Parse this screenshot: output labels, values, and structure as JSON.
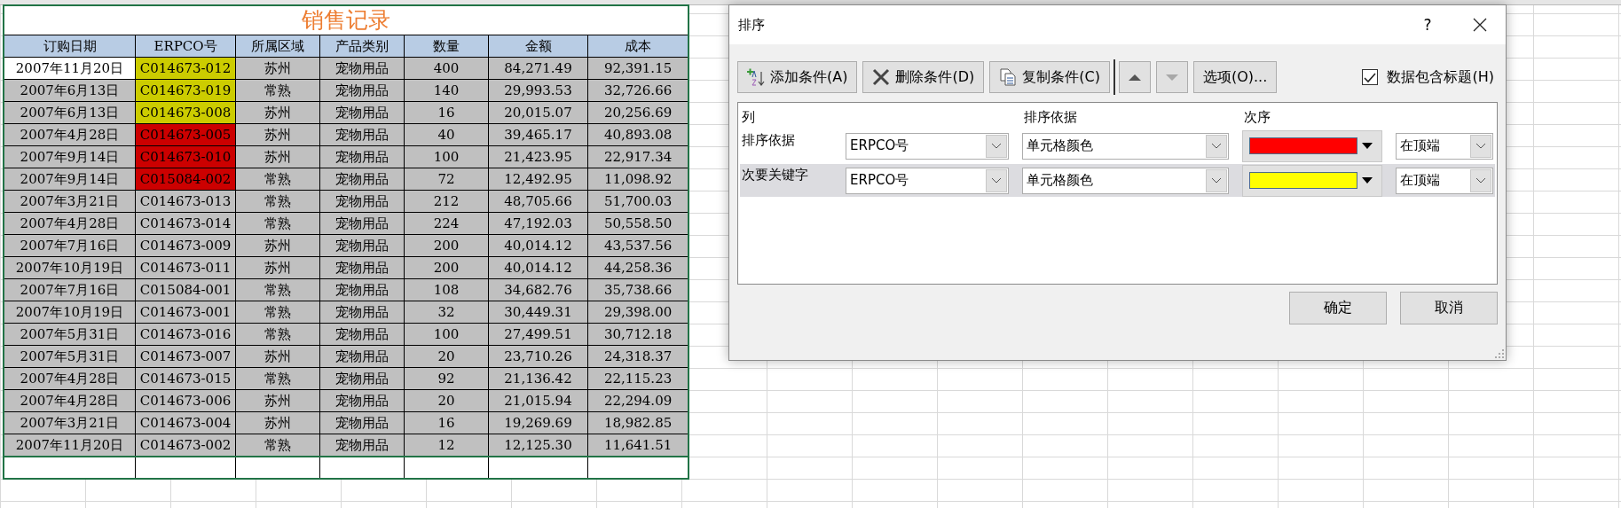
{
  "sheet": {
    "title": "销售记录",
    "columns": [
      "订购日期",
      "ERPCO号",
      "所属区域",
      "产品类别",
      "数量",
      "金额",
      "成本"
    ],
    "rows": [
      {
        "date": "2007年11月20日",
        "erpco": "C014673-012",
        "color": "#cccc00",
        "selected": true,
        "region": "苏州",
        "category": "宠物用品",
        "qty": "400",
        "amount": "84,271.49",
        "cost": "92,391.15"
      },
      {
        "date": "2007年6月13日",
        "erpco": "C014673-019",
        "color": "#cccc00",
        "selected": false,
        "region": "常熟",
        "category": "宠物用品",
        "qty": "140",
        "amount": "29,993.53",
        "cost": "32,726.66"
      },
      {
        "date": "2007年6月13日",
        "erpco": "C014673-008",
        "color": "#cccc00",
        "selected": false,
        "region": "苏州",
        "category": "宠物用品",
        "qty": "16",
        "amount": "20,015.07",
        "cost": "20,256.69"
      },
      {
        "date": "2007年4月28日",
        "erpco": "C014673-005",
        "color": "#cc0000",
        "selected": false,
        "region": "苏州",
        "category": "宠物用品",
        "qty": "40",
        "amount": "39,465.17",
        "cost": "40,893.08"
      },
      {
        "date": "2007年9月14日",
        "erpco": "C014673-010",
        "color": "#cc0000",
        "selected": false,
        "region": "苏州",
        "category": "宠物用品",
        "qty": "100",
        "amount": "21,423.95",
        "cost": "22,917.34"
      },
      {
        "date": "2007年9月14日",
        "erpco": "C015084-002",
        "color": "#cc0000",
        "selected": false,
        "region": "常熟",
        "category": "宠物用品",
        "qty": "72",
        "amount": "12,492.95",
        "cost": "11,098.92"
      },
      {
        "date": "2007年3月21日",
        "erpco": "C014673-013",
        "selected": false,
        "region": "常熟",
        "category": "宠物用品",
        "qty": "212",
        "amount": "48,705.66",
        "cost": "51,700.03"
      },
      {
        "date": "2007年4月28日",
        "erpco": "C014673-014",
        "selected": false,
        "region": "常熟",
        "category": "宠物用品",
        "qty": "224",
        "amount": "47,192.03",
        "cost": "50,558.50"
      },
      {
        "date": "2007年7月16日",
        "erpco": "C014673-009",
        "selected": false,
        "region": "苏州",
        "category": "宠物用品",
        "qty": "200",
        "amount": "40,014.12",
        "cost": "43,537.56"
      },
      {
        "date": "2007年10月19日",
        "erpco": "C014673-011",
        "selected": false,
        "region": "苏州",
        "category": "宠物用品",
        "qty": "200",
        "amount": "40,014.12",
        "cost": "44,258.36"
      },
      {
        "date": "2007年7月16日",
        "erpco": "C015084-001",
        "selected": false,
        "region": "常熟",
        "category": "宠物用品",
        "qty": "108",
        "amount": "34,682.76",
        "cost": "35,738.66"
      },
      {
        "date": "2007年10月19日",
        "erpco": "C014673-001",
        "selected": false,
        "region": "常熟",
        "category": "宠物用品",
        "qty": "32",
        "amount": "30,449.31",
        "cost": "29,398.00"
      },
      {
        "date": "2007年5月31日",
        "erpco": "C014673-016",
        "selected": false,
        "region": "常熟",
        "category": "宠物用品",
        "qty": "100",
        "amount": "27,499.51",
        "cost": "30,712.18"
      },
      {
        "date": "2007年5月31日",
        "erpco": "C014673-007",
        "selected": false,
        "region": "苏州",
        "category": "宠物用品",
        "qty": "20",
        "amount": "23,710.26",
        "cost": "24,318.37"
      },
      {
        "date": "2007年4月28日",
        "erpco": "C014673-015",
        "selected": false,
        "region": "常熟",
        "category": "宠物用品",
        "qty": "92",
        "amount": "21,136.42",
        "cost": "22,115.23"
      },
      {
        "date": "2007年4月28日",
        "erpco": "C014673-006",
        "selected": false,
        "region": "苏州",
        "category": "宠物用品",
        "qty": "20",
        "amount": "21,015.94",
        "cost": "22,294.09"
      },
      {
        "date": "2007年3月21日",
        "erpco": "C014673-004",
        "selected": false,
        "region": "苏州",
        "category": "宠物用品",
        "qty": "16",
        "amount": "19,269.69",
        "cost": "18,982.85"
      },
      {
        "date": "2007年11月20日",
        "erpco": "C014673-002",
        "selected": false,
        "region": "常熟",
        "category": "宠物用品",
        "qty": "12",
        "amount": "12,125.30",
        "cost": "11,641.51"
      }
    ]
  },
  "dialog": {
    "title": "排序",
    "help": "?",
    "toolbar": [
      {
        "kind": "add",
        "label": "添加条件(A)"
      },
      {
        "kind": "delete",
        "label": "删除条件(D)"
      },
      {
        "kind": "copy",
        "label": "复制条件(C)"
      }
    ],
    "move_up": {
      "disabled": false
    },
    "move_down": {
      "disabled": true
    },
    "options_button": "选项(O)...",
    "header_checkbox": {
      "label": "数据包含标题(H)",
      "checked": true
    },
    "grid_headers": [
      "列",
      "排序依据",
      "次序"
    ],
    "levels": [
      {
        "label": "排序依据",
        "column": "ERPCO号",
        "sort_on": "单元格颜色",
        "color": "#ff0000",
        "position": "在顶端",
        "selected": false
      },
      {
        "label": "次要关键字",
        "column": "ERPCO号",
        "sort_on": "单元格颜色",
        "color": "#ffff00",
        "position": "在顶端",
        "selected": true
      }
    ],
    "buttons": [
      "确定",
      "取消"
    ]
  }
}
